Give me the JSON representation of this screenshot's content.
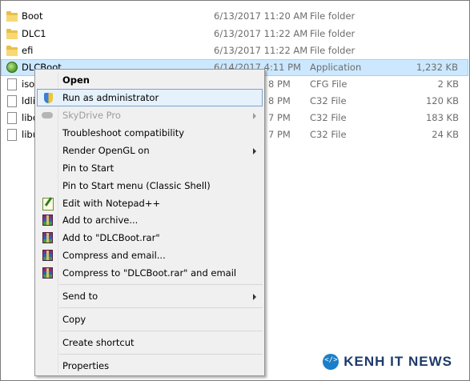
{
  "files": [
    {
      "name": "Boot",
      "date": "6/13/2017 11:20 AM",
      "type": "File folder",
      "size": "",
      "icon": "folder-icon"
    },
    {
      "name": "DLC1",
      "date": "6/13/2017 11:22 AM",
      "type": "File folder",
      "size": "",
      "icon": "folder-icon"
    },
    {
      "name": "efi",
      "date": "6/13/2017 11:22 AM",
      "type": "File folder",
      "size": "",
      "icon": "folder-icon"
    },
    {
      "name": "DLCBoot",
      "date": "6/14/2017 4:11 PM",
      "type": "Application",
      "size": "1,232 KB",
      "icon": "application-icon"
    },
    {
      "name": "iso",
      "date": "8 PM",
      "type": "CFG File",
      "size": "2 KB",
      "icon": "file-icon"
    },
    {
      "name": "ldli",
      "date": "8 PM",
      "type": "C32 File",
      "size": "120 KB",
      "icon": "file-icon"
    },
    {
      "name": "libc",
      "date": "7 PM",
      "type": "C32 File",
      "size": "183 KB",
      "icon": "file-icon"
    },
    {
      "name": "libu",
      "date": "7 PM",
      "type": "C32 File",
      "size": "24 KB",
      "icon": "file-icon"
    }
  ],
  "menu": {
    "open": "Open",
    "run_as_admin": "Run as administrator",
    "skydrive_pro": "SkyDrive Pro",
    "troubleshoot": "Troubleshoot compatibility",
    "render_opengl": "Render OpenGL on",
    "pin_start": "Pin to Start",
    "pin_start_classic": "Pin to Start menu (Classic Shell)",
    "edit_notepad": "Edit with Notepad++",
    "add_archive": "Add to archive...",
    "add_rar": "Add to \"DLCBoot.rar\"",
    "compress_email": "Compress and email...",
    "compress_rar_email": "Compress to \"DLCBoot.rar\" and email",
    "send_to": "Send to",
    "copy": "Copy",
    "create_shortcut": "Create shortcut",
    "properties": "Properties"
  },
  "watermark": "KENH IT NEWS",
  "colors": {
    "selection": "#cce8ff",
    "menu_highlight": "#e5f1fb"
  }
}
